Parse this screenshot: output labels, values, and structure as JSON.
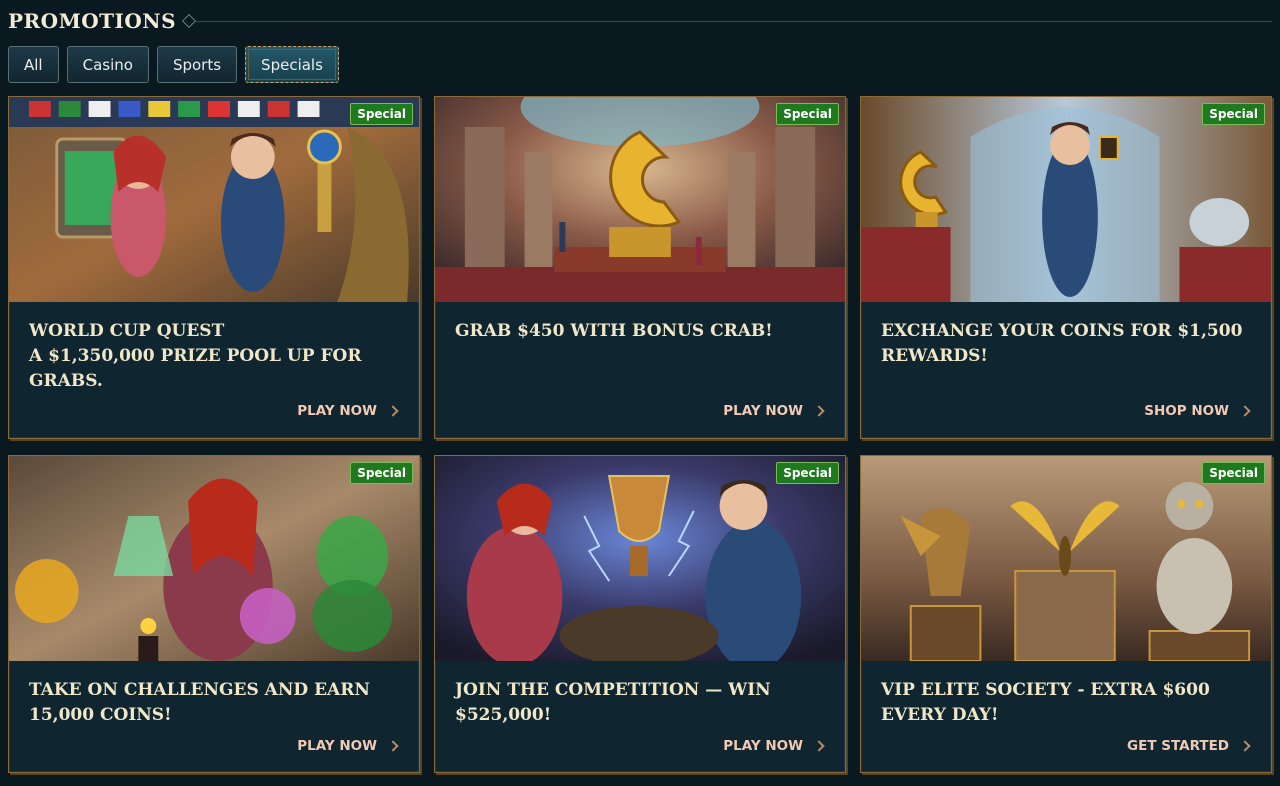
{
  "header": {
    "title": "PROMOTIONS"
  },
  "filters": [
    {
      "label": "All",
      "active": false
    },
    {
      "label": "Casino",
      "active": false
    },
    {
      "label": "Sports",
      "active": false
    },
    {
      "label": "Specials",
      "active": true
    }
  ],
  "promotions": [
    {
      "badge": "Special",
      "title": "WORLD CUP QUEST\nA $1,350,000 PRIZE POOL UP FOR GRABS.",
      "cta": "PLAY NOW",
      "image": "world-cup-tablet-trophy"
    },
    {
      "badge": "Special",
      "title": "GRAB $450 WITH BONUS CRAB!",
      "cta": "PLAY NOW",
      "image": "golden-crab-logo-hall"
    },
    {
      "badge": "Special",
      "title": "EXCHANGE YOUR COINS FOR $1,500 REWARDS!",
      "cta": "SHOP NOW",
      "image": "shopkeeper-coins"
    },
    {
      "badge": "Special",
      "title": "TAKE ON CHALLENGES AND EARN 15,000 COINS!",
      "cta": "PLAY NOW",
      "image": "alchemy-potions"
    },
    {
      "badge": "Special",
      "title": "JOIN THE COMPETITION — WIN $525,000!",
      "cta": "PLAY NOW",
      "image": "electric-trophy"
    },
    {
      "badge": "Special",
      "title": "VIP ELITE SOCIETY - EXTRA $600 EVERY DAY!",
      "cta": "GET STARTED",
      "image": "mechanical-animals"
    }
  ],
  "colors": {
    "background": "#0a1820",
    "card": "#0f2630",
    "badge": "#1f7a1f",
    "title": "#f0e6c8",
    "cta": "#f2c9b5",
    "border": "#8a6a3a"
  }
}
